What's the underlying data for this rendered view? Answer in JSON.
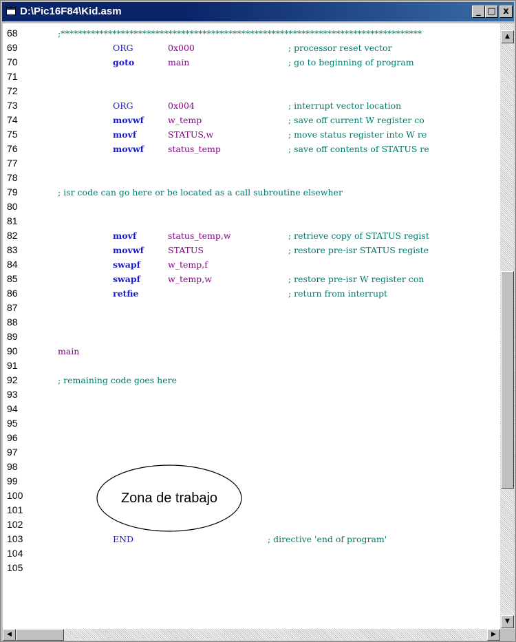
{
  "window": {
    "title": "D:\\Pic16F84\\Kid.asm",
    "controls": {
      "minimize": "_",
      "maximize": "□",
      "close": "x"
    },
    "title_color": "#0a246a"
  },
  "editor": {
    "lines": [
      {
        "num": "68",
        "code": ";************************************************************************************"
      },
      {
        "num": "69",
        "instr": "ORG",
        "operand": "0x000",
        "comment": "; processor reset vector"
      },
      {
        "num": "70",
        "instr": "goto",
        "operand": "main",
        "comment": "; go to beginning of program"
      },
      {
        "num": "71"
      },
      {
        "num": "72"
      },
      {
        "num": "73",
        "instr": "ORG",
        "operand": "0x004",
        "comment": "; interrupt vector location"
      },
      {
        "num": "74",
        "instr": "movwf",
        "operand": "w_temp",
        "comment": "; save off current W register co"
      },
      {
        "num": "75",
        "instr": "movf",
        "operand": "STATUS,w",
        "comment": "; move status register into W re"
      },
      {
        "num": "76",
        "instr": "movwf",
        "operand": "status_temp",
        "comment": "; save off contents of STATUS re"
      },
      {
        "num": "77"
      },
      {
        "num": "78"
      },
      {
        "num": "79",
        "code": "; isr code can go here or be located as a call subroutine elsewher"
      },
      {
        "num": "80"
      },
      {
        "num": "81"
      },
      {
        "num": "82",
        "instr": "movf",
        "operand": "status_temp,w",
        "comment": "; retrieve copy of STATUS regist"
      },
      {
        "num": "83",
        "instr": "movwf",
        "operand": "STATUS",
        "comment": "; restore pre-isr STATUS registe"
      },
      {
        "num": "84",
        "instr": "swapf",
        "operand": "w_temp,f"
      },
      {
        "num": "85",
        "instr": "swapf",
        "operand": "w_temp,w",
        "comment": "; restore pre-isr W register con"
      },
      {
        "num": "86",
        "instr": "retfie",
        "comment": "; return from interrupt"
      },
      {
        "num": "87"
      },
      {
        "num": "88"
      },
      {
        "num": "89"
      },
      {
        "num": "90",
        "label": "main"
      },
      {
        "num": "91"
      },
      {
        "num": "92",
        "code": "; remaining code goes here"
      },
      {
        "num": "93"
      },
      {
        "num": "94"
      },
      {
        "num": "95"
      },
      {
        "num": "96"
      },
      {
        "num": "97"
      },
      {
        "num": "98"
      },
      {
        "num": "99"
      },
      {
        "num": "100"
      },
      {
        "num": "101"
      },
      {
        "num": "102"
      },
      {
        "num": "103",
        "instr": "END",
        "end_comment": "; directive 'end of program'"
      },
      {
        "num": "104"
      },
      {
        "num": "105"
      }
    ]
  },
  "annotation": {
    "text": "Zona de trabajo"
  },
  "scrollbars": {
    "vertical": {
      "up_arrow": "▲",
      "down_arrow": "▼"
    },
    "horizontal": {
      "left_arrow": "◀",
      "right_arrow": "▶"
    }
  },
  "icons": [
    "window-icon",
    "minimize-icon",
    "maximize-icon",
    "close-icon",
    "scroll-up-icon",
    "scroll-down-icon",
    "scroll-left-icon",
    "scroll-right-icon"
  ]
}
